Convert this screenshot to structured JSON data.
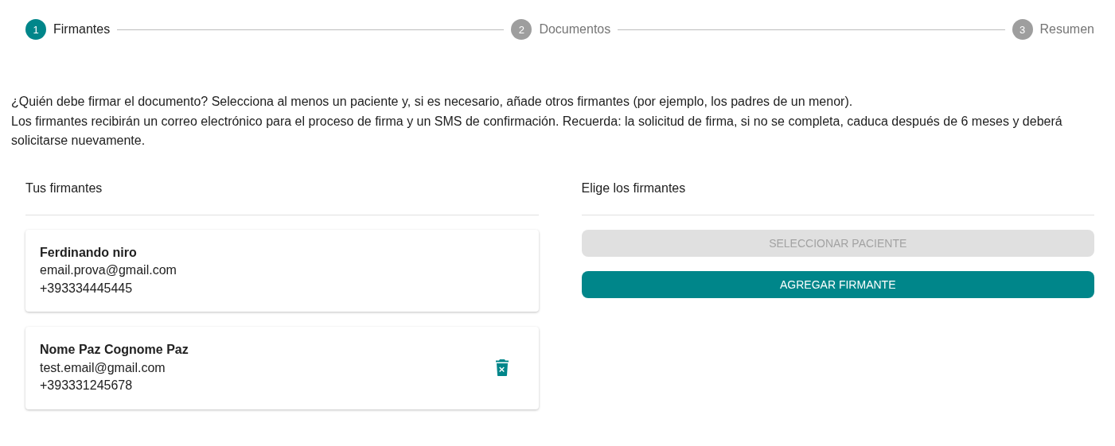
{
  "steps": [
    {
      "number": "1",
      "label": "Firmantes",
      "selected": true
    },
    {
      "number": "2",
      "label": "Documentos",
      "selected": false
    },
    {
      "number": "3",
      "label": "Resumen",
      "selected": false
    }
  ],
  "intro": [
    "¿Quién debe firmar el documento? Selecciona al menos un paciente y, si es necesario, añade otros firmantes (por ejemplo, los padres de un menor).",
    "Los firmantes recibirán un correo electrónico para el proceso de firma y un SMS de confirmación. Recuerda: la solicitud de firma, si no se completa, caduca después de 6 meses y deberá solicitarse nuevamente."
  ],
  "your_signers": {
    "title": "Tus firmantes",
    "signers": [
      {
        "name": "Ferdinando niro",
        "email": "email.prova@gmail.com",
        "phone": "+393334445445",
        "removable": false
      },
      {
        "name": "Nome Paz Cognome Paz",
        "email": "test.email@gmail.com",
        "phone": "+393331245678",
        "removable": true
      }
    ]
  },
  "choose_signers": {
    "title": "Elige los firmantes",
    "buttons": [
      {
        "label": "SELECCIONAR PACIENTE",
        "disabled": true
      },
      {
        "label": "AGREGAR FIRMANTE",
        "disabled": false
      }
    ]
  }
}
